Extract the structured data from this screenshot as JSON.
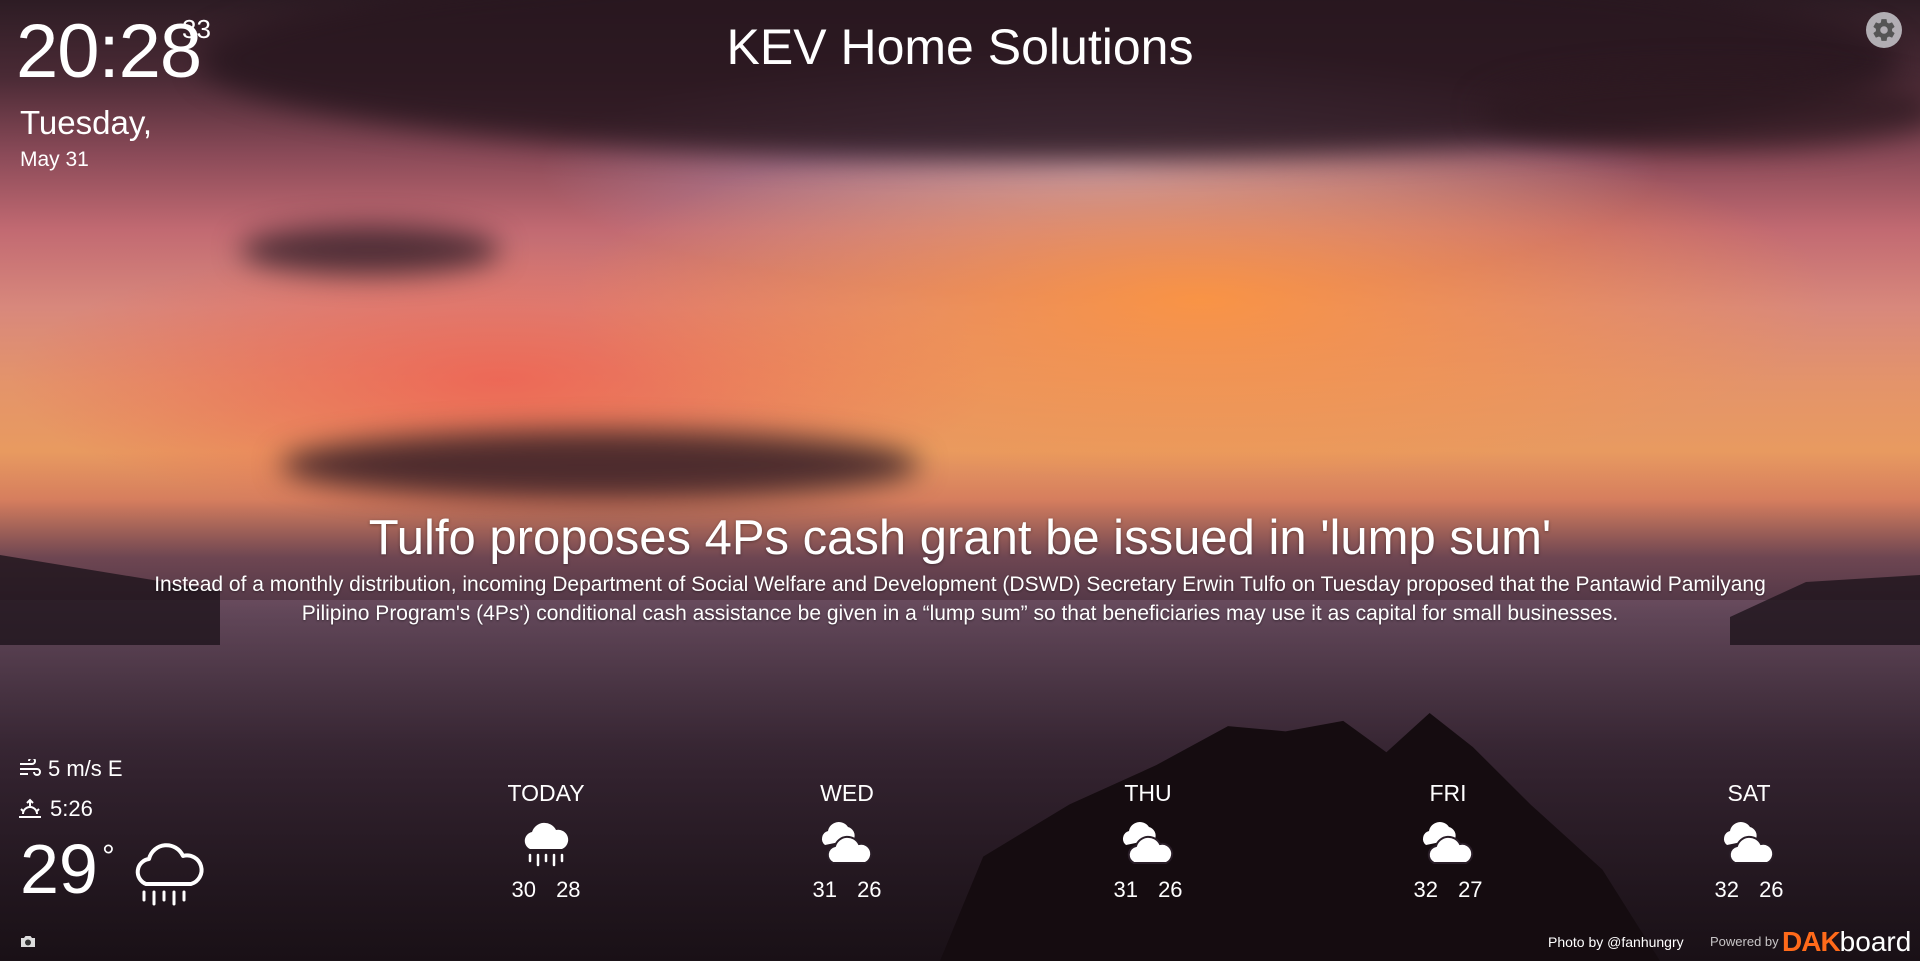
{
  "clock": {
    "time": "20:28",
    "seconds": "33",
    "weekday": "Tuesday,",
    "date": "May 31"
  },
  "header": {
    "title": "KEV Home Solutions",
    "settings_icon": "gear-icon"
  },
  "news": {
    "headline": "Tulfo proposes 4Ps cash grant be issued in 'lump sum'",
    "summary": "Instead of a monthly distribution, incoming Department of Social Welfare and Development (DSWD) Secretary Erwin Tulfo on Tuesday proposed that the Pantawid Pamilyang Pilipino Program's (4Ps') conditional cash assistance be given in a “lump sum” so that beneficiaries may use it as capital for small businesses."
  },
  "current_weather": {
    "wind": "5 m/s E",
    "wind_icon": "wind-icon",
    "sunrise": "5:26",
    "sunrise_icon": "sunrise-icon",
    "temperature": "29",
    "degree_symbol": "°",
    "condition_icon": "rain-cloud-icon"
  },
  "forecast": [
    {
      "day": "TODAY",
      "icon": "rain-cloud-icon",
      "high": "30",
      "low": "28"
    },
    {
      "day": "WED",
      "icon": "cloudy-icon",
      "high": "31",
      "low": "26"
    },
    {
      "day": "THU",
      "icon": "cloudy-icon",
      "high": "31",
      "low": "26"
    },
    {
      "day": "FRI",
      "icon": "cloudy-icon",
      "high": "32",
      "low": "27"
    },
    {
      "day": "SAT",
      "icon": "cloudy-icon",
      "high": "32",
      "low": "26"
    }
  ],
  "footer": {
    "camera_icon": "camera-icon",
    "photo_credit": "Photo by @fanhungry",
    "powered_by": "Powered by",
    "logo_part1": "DAK",
    "logo_part2": "board"
  },
  "colors": {
    "logo_accent": "#ff6a1a",
    "text": "#ffffff"
  }
}
